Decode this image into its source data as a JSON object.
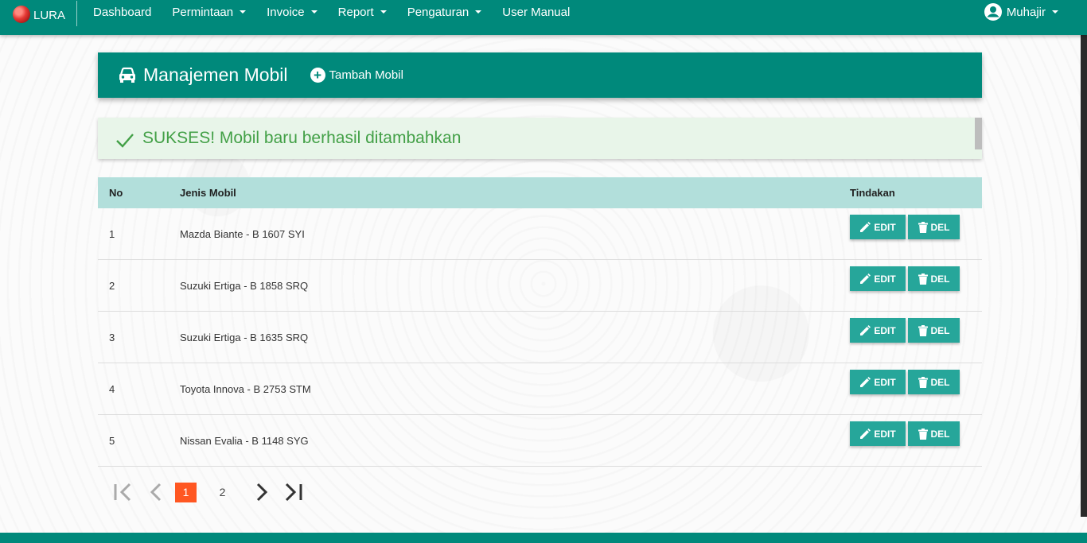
{
  "navbar": {
    "brand": "LURA",
    "items": [
      {
        "label": "Dashboard",
        "dropdown": false
      },
      {
        "label": "Permintaan",
        "dropdown": true
      },
      {
        "label": "Invoice",
        "dropdown": true
      },
      {
        "label": "Report",
        "dropdown": true
      },
      {
        "label": "Pengaturan",
        "dropdown": true
      },
      {
        "label": "User Manual",
        "dropdown": false
      }
    ],
    "user": "Muhajir"
  },
  "header": {
    "title": "Manajemen Mobil",
    "add_label": "Tambah Mobil",
    "icon": "car-icon"
  },
  "alert": {
    "message": "SUKSES! Mobil baru berhasil ditambahkan",
    "icon": "check-icon"
  },
  "table": {
    "headers": {
      "no": "No",
      "jenis": "Jenis Mobil",
      "aksi": "Tindakan"
    },
    "rows": [
      {
        "no": "1",
        "jenis": "Mazda Biante - B 1607 SYI"
      },
      {
        "no": "2",
        "jenis": "Suzuki Ertiga - B 1858 SRQ"
      },
      {
        "no": "3",
        "jenis": "Suzuki Ertiga - B 1635 SRQ"
      },
      {
        "no": "4",
        "jenis": "Toyota Innova - B 2753 STM"
      },
      {
        "no": "5",
        "jenis": "Nissan Evalia - B 1148 SYG"
      }
    ],
    "edit_label": "EDIT",
    "del_label": "DEL"
  },
  "pagination": {
    "pages": [
      "1",
      "2"
    ],
    "active": "1"
  },
  "colors": {
    "primary": "#00897b",
    "button": "#26a69a",
    "table_header": "#b2dfdb",
    "alert_bg": "#e8f5e9",
    "alert_text": "#43a047",
    "active_page": "#ff5722"
  }
}
